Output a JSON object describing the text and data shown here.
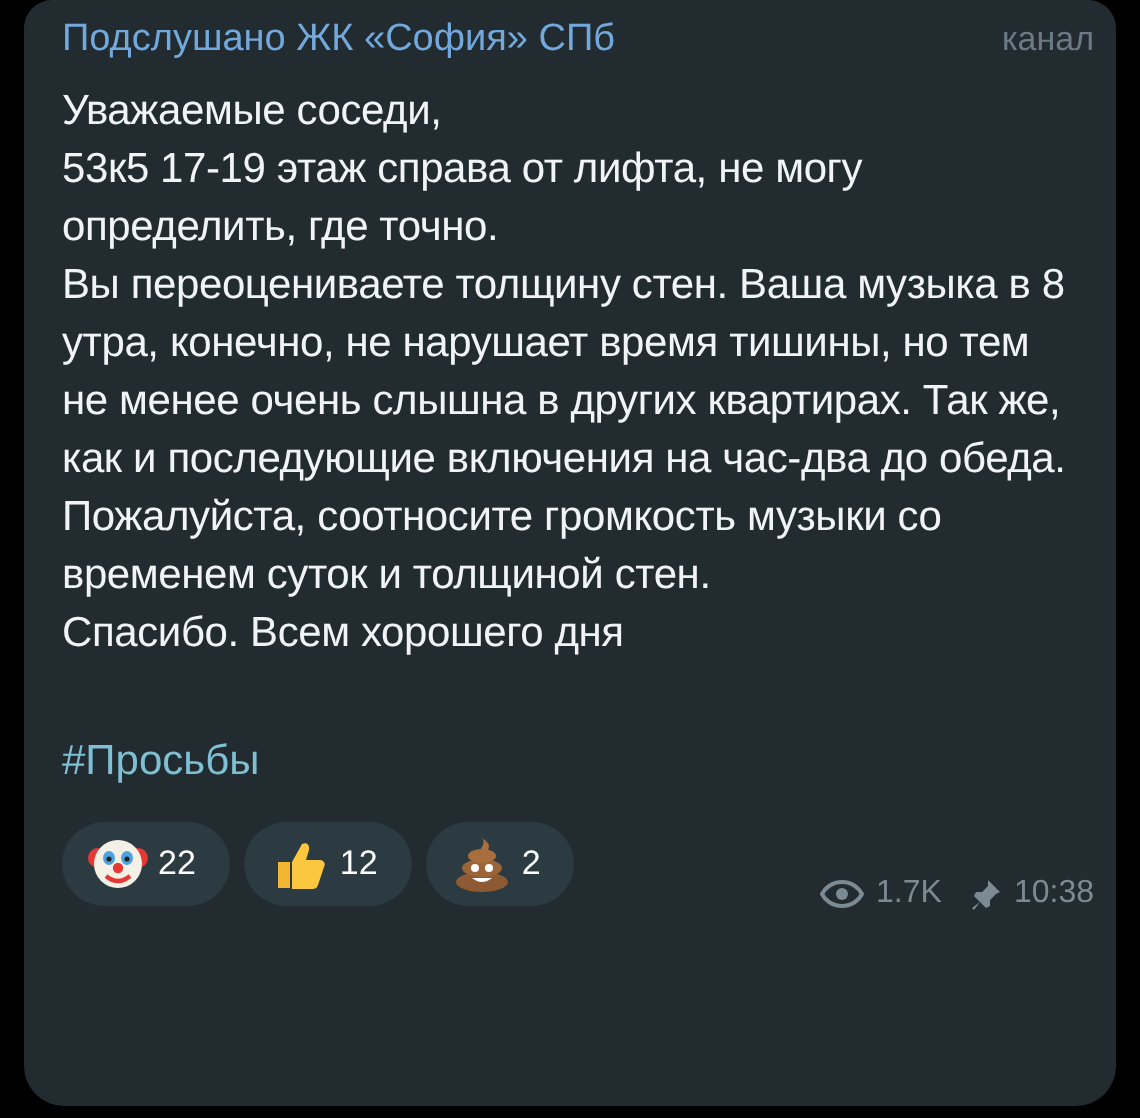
{
  "channel": {
    "name": "Подслушано ЖК «София» СПб",
    "badge": "канал"
  },
  "paragraphs": [
    "Уважаемые соседи,",
    "53к5 17-19 этаж справа от лифта, не могу определить, где точно.",
    "Вы переоцениваете толщину стен. Ваша музыка в 8 утра, конечно, не нарушает время тишины, но тем не менее очень слышна в других квартирах. Так же, как и последующие включения на час-два до обеда.",
    "Пожалуйста, соотносите громкость музыки со временем суток и толщиной стен.",
    "Спасибо. Всем хорошего дня"
  ],
  "hashtag": "#Просьбы",
  "reactions": [
    {
      "kind": "clown",
      "count": "22"
    },
    {
      "kind": "thumbs_up",
      "count": "12"
    },
    {
      "kind": "poop",
      "count": "2"
    }
  ],
  "views": "1.7K",
  "time": "10:38"
}
